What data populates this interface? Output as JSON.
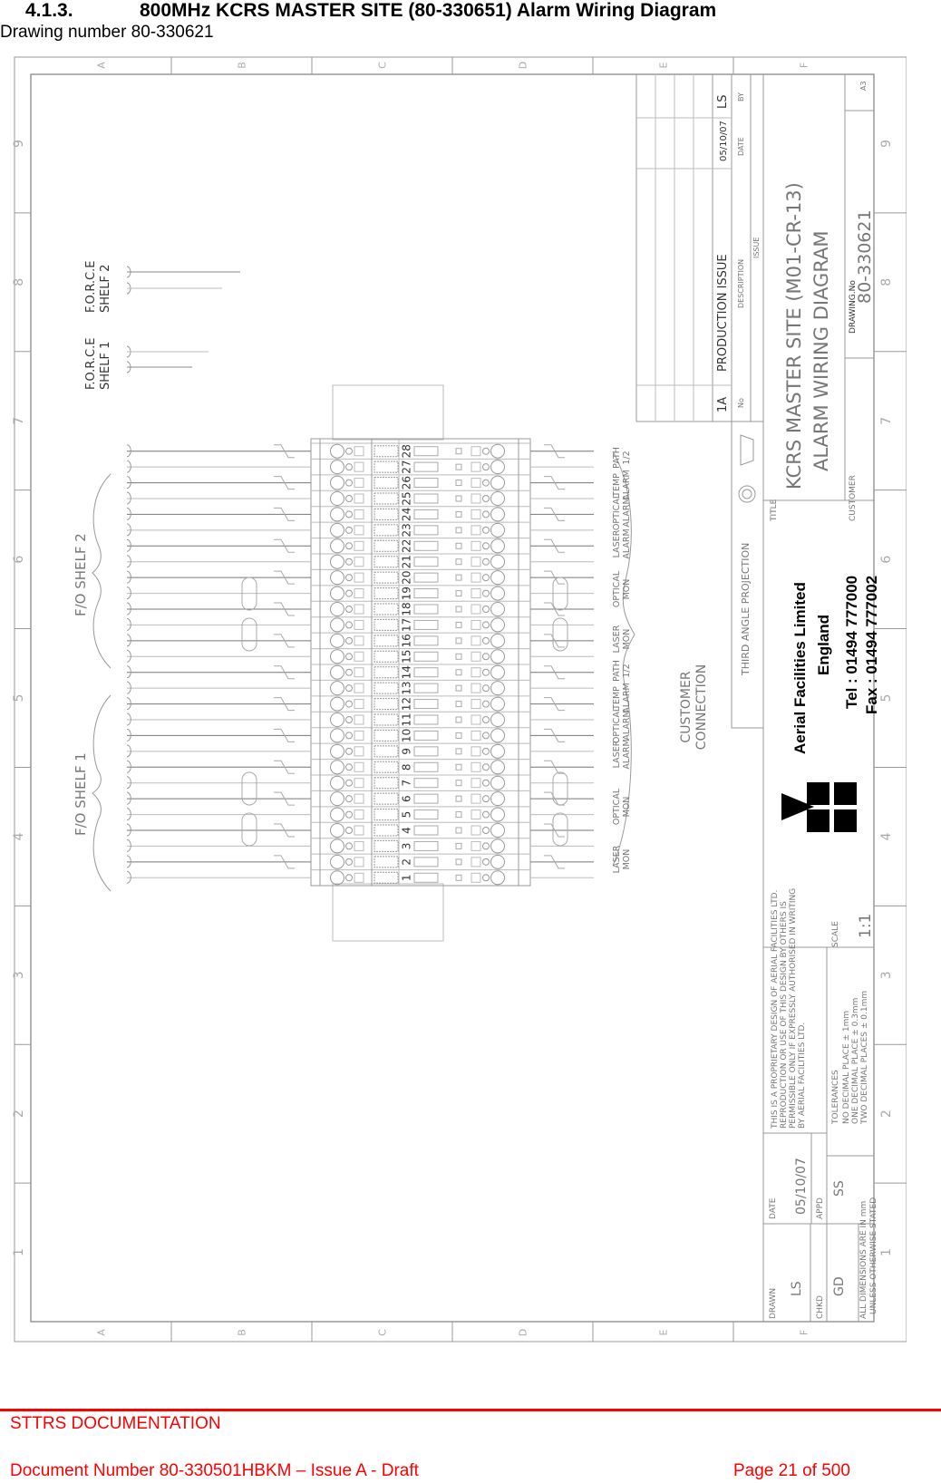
{
  "header": {
    "section_number": "4.1.3.",
    "section_title": "800MHz KCRS MASTER SITE (80-330651) Alarm Wiring Diagram",
    "subtitle": "Drawing number 80-330621"
  },
  "drawing": {
    "border": {
      "zone_letters": [
        "A",
        "B",
        "C",
        "D",
        "E",
        "F"
      ],
      "zone_numbers": [
        "9",
        "8",
        "7",
        "6",
        "5",
        "4",
        "3",
        "2",
        "1"
      ]
    },
    "sources": {
      "force_shelf_1": "F.O.R.C.E SHELF 1",
      "force_shelf_1_lines": [
        "F.O.R.C.E",
        "SHELF 1"
      ],
      "force_shelf_2_lines": [
        "F.O.R.C.E",
        "SHELF 2"
      ],
      "fo_shelf_1": "F/O SHELF 1",
      "fo_shelf_2": "F/O SHELF 2"
    },
    "terminal_numbers": [
      "1",
      "2",
      "3",
      "4",
      "5",
      "6",
      "7",
      "8",
      "9",
      "10",
      "11",
      "12",
      "13",
      "14",
      "15",
      "16",
      "17",
      "18",
      "19",
      "20",
      "21",
      "22",
      "23",
      "24",
      "25",
      "26",
      "27",
      "28"
    ],
    "signal_labels": [
      {
        "lines": [
          "LASER",
          "MON"
        ]
      },
      {
        "lines": [
          "OPTICAL",
          "MON"
        ]
      },
      {
        "lines": [
          "LASER",
          "ALARM"
        ]
      },
      {
        "lines": [
          "OPTICAL",
          "ALARM"
        ]
      },
      {
        "lines": [
          "TEMP",
          "ALARM"
        ]
      },
      {
        "lines": [
          "PATH",
          "1/2"
        ]
      },
      {
        "lines": [
          "LASER",
          "MON"
        ]
      },
      {
        "lines": [
          "OPTICAL",
          "MON"
        ]
      },
      {
        "lines": [
          "LASER",
          "ALARM"
        ]
      },
      {
        "lines": [
          "OPTICAL",
          "ALARM"
        ]
      },
      {
        "lines": [
          "TEMP",
          "ALARM"
        ]
      },
      {
        "lines": [
          "PATH",
          "1/2"
        ]
      }
    ],
    "customer_connection": [
      "CUSTOMER",
      "CONNECTION"
    ],
    "revision_table": {
      "row": {
        "no": "1A",
        "description": "PRODUCTION ISSUE",
        "date": "05/10/07",
        "by": "LS"
      },
      "headers": {
        "no": "No",
        "description": "DESCRIPTION",
        "date": "DATE",
        "by": "BY"
      },
      "caption": "ISSUE"
    },
    "title_block": {
      "projection": "THIRD ANGLE PROJECTION",
      "title_label": "TITLE",
      "title_line_1": "KCRS MASTER SITE (M01-CR-13)",
      "title_line_2": "ALARM WIRING DIAGRAM",
      "customer_label": "CUSTOMER",
      "drawing_no_label": "DRAWING.No",
      "drawing_no": "80-330621",
      "sheet_size": "A3",
      "company_name": "Aerial Facilities Limited",
      "company_country": "England",
      "tel": "Tel : 01494 777000",
      "fax": "Fax : 01494 777002",
      "proprietary_notice": [
        "THIS IS A PROPRIETARY DESIGN OF AERIAL FACILITIES LTD.",
        "REPRODUCTION OR USE OF THIS DESIGN BY OTHERS IS",
        "PERMISSIBLE ONLY IF EXPRESSLY AUTHORISED IN WRITING",
        "BY AERIAL FACILITIES LTD."
      ],
      "scale_label": "SCALE",
      "scale": "1:1",
      "tolerances_label": "TOLERANCES",
      "tolerances": [
        "NO DECIMAL PLACE ± 1mm",
        "ONE DECIMAL PLACE ± 0.3mm",
        "TWO DECIMAL PLACES ± 0.1mm"
      ],
      "drawn_label": "DRAWN",
      "drawn": "LS",
      "date_label": "DATE",
      "date": "05/10/07",
      "chkd_label": "CHKD",
      "chkd": "GD",
      "appd_label": "APPD",
      "appd": "SS",
      "dimensions_note": [
        "ALL DIMENSIONS ARE IN mm",
        "UNLESS OTHERWISE STATED"
      ]
    }
  },
  "footer": {
    "org": "STTRS DOCUMENTATION",
    "document": "Document Number 80-330501HBKM – Issue A - Draft",
    "page": "Page 21 of 500"
  },
  "colors": {
    "footer_red": "#ff0000",
    "line_gray": "#888888"
  }
}
